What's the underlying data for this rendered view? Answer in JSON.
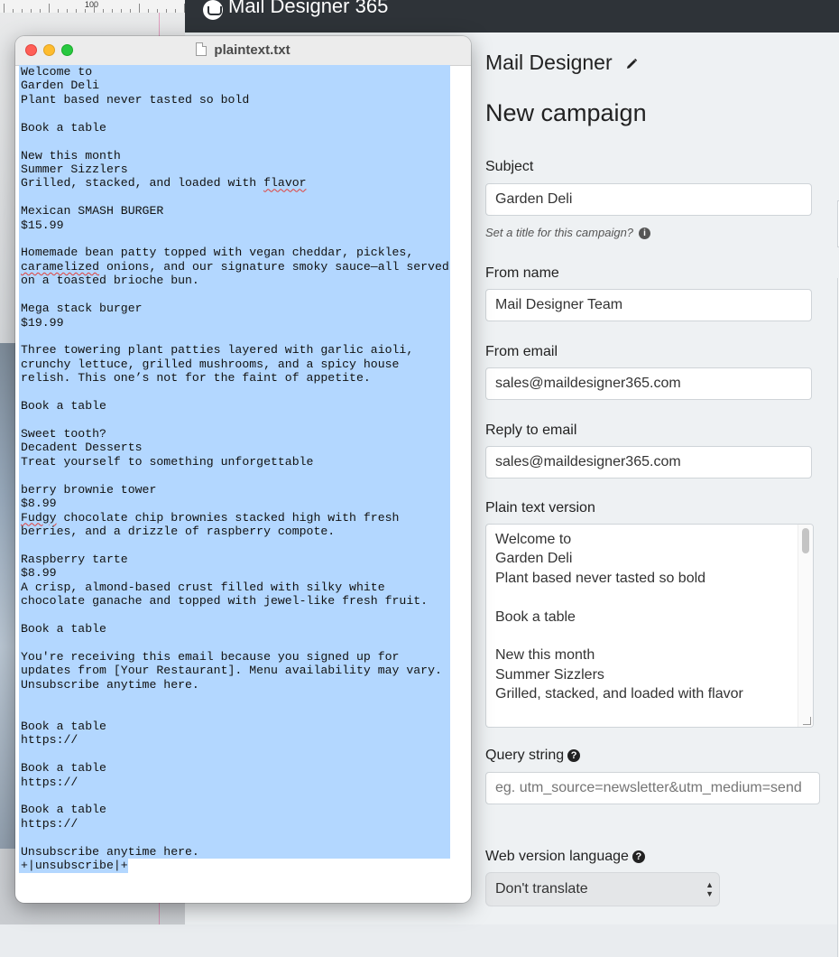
{
  "app": {
    "title": "Mail Designer 365"
  },
  "ruler": {
    "label": "100"
  },
  "panel": {
    "brand": "Mail Designer",
    "page_title": "New campaign",
    "subject": {
      "label": "Subject",
      "value": "Garden Deli",
      "hint": "Set a title for this campaign?"
    },
    "from_name": {
      "label": "From name",
      "value": "Mail Designer Team"
    },
    "from_email": {
      "label": "From email",
      "value": "sales@maildesigner365.com"
    },
    "reply_email": {
      "label": "Reply to email",
      "value": "sales@maildesigner365.com"
    },
    "plain_text": {
      "label": "Plain text version",
      "lines": [
        "Welcome to",
        "Garden Deli",
        "Plant based never tasted so bold",
        "",
        "Book a table",
        "",
        "New this month",
        "Summer Sizzlers",
        "Grilled, stacked, and loaded with flavor"
      ]
    },
    "query_string": {
      "label": "Query string",
      "placeholder": "eg. utm_source=newsletter&utm_medium=send"
    },
    "web_language": {
      "label": "Web version language",
      "value": "Don't translate"
    }
  },
  "textedit": {
    "filename": "plaintext.txt",
    "lines": [
      "Welcome to",
      "Garden Deli",
      "Plant based never tasted so bold",
      "",
      "Book a table",
      "",
      "New this month",
      "Summer Sizzlers",
      "Grilled, stacked, and loaded with flavor",
      "",
      "Mexican SMASH BURGER",
      "$15.99",
      "",
      "Homemade bean patty topped with vegan cheddar, pickles,",
      "caramelized onions, and our signature smoky sauce—all served",
      "on a toasted brioche bun.",
      "",
      "Mega stack burger",
      "$19.99",
      "",
      "Three towering plant patties layered with garlic aioli,",
      "crunchy lettuce, grilled mushrooms, and a spicy house",
      "relish. This one’s not for the faint of appetite.",
      "",
      "Book a table",
      "",
      "Sweet tooth?",
      "Decadent Desserts",
      "Treat yourself to something unforgettable",
      "",
      "berry brownie tower",
      "$8.99",
      "Fudgy chocolate chip brownies stacked high with fresh",
      "berries, and a drizzle of raspberry compote.",
      "",
      "Raspberry tarte",
      "$8.99",
      "A crisp, almond-based crust filled with silky white",
      "chocolate ganache and topped with jewel-like fresh fruit.",
      "",
      "Book a table",
      "",
      "You're receiving this email because you signed up for",
      "updates from [Your Restaurant]. Menu availability may vary.",
      "Unsubscribe anytime here.",
      "",
      "",
      "Book a table",
      "https://",
      "",
      "Book a table",
      "https://",
      "",
      "Book a table",
      "https://",
      "",
      "Unsubscribe anytime here.",
      "+|unsubscribe|+"
    ],
    "squiggle_words": [
      "flavor",
      "caramelized",
      "Fudgy"
    ]
  },
  "colors": {
    "selection": "#b3d7ff",
    "topbar": "#2e3338",
    "traffic_red": "#ff5f57",
    "traffic_yellow": "#febc2e",
    "traffic_green": "#28c840"
  }
}
